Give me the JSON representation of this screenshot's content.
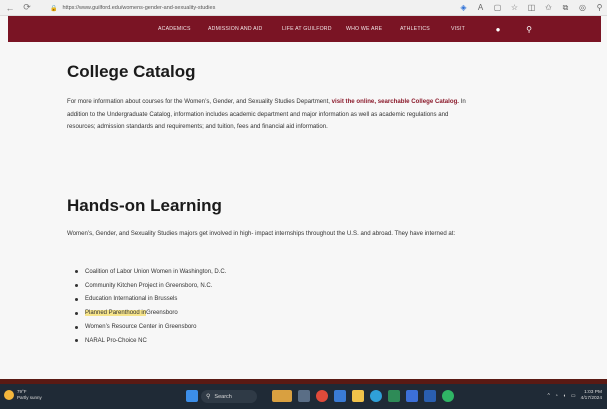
{
  "browser": {
    "url": "https://www.guilford.edu/womens-gender-and-sexuality-studies",
    "back_icon": "arrow-left",
    "reload_icon": "reload"
  },
  "sitenav": {
    "items": [
      "Academics",
      "Admission and Aid",
      "Life at Guilford",
      "Who We Are",
      "Athletics",
      "Visit"
    ]
  },
  "catalog": {
    "title": "College Catalog",
    "text_before": "For more information about courses for the Women’s, Gender, and Sexuality Studies Department, ",
    "link": "visit the online, searchable College Catalog.",
    "text_after": " In addition to the Undergraduate Catalog, information includes academic department and major information as well as academic regulations and resources; admission standards and requirements; and tuition, fees and financial aid information."
  },
  "hands_on": {
    "title": "Hands-on Learning",
    "intro": "Women’s, Gender, and Sexuality Studies majors get involved in high- impact internships throughout the U.S. and abroad. They have interned at:",
    "list": [
      "Coalition of Labor Union Women in Washington, D.C.",
      "Community Kitchen Project in Greensboro, N.C.",
      "Education International in Brussels",
      "Planned Parenthood in Greensboro",
      "Women’s Resource Center in Greensboro",
      "NARAL Pro-Choice NC"
    ],
    "highlight_text": "Planned Parenthood in",
    "highlight_rest": " Greensboro"
  },
  "taskbar": {
    "weather_temp": "79°F",
    "weather_desc": "Partly sunny",
    "search_label": "Search",
    "time": "1:03 PM",
    "date": "4/17/2024"
  },
  "colors": {
    "brand": "#7a1424",
    "link": "#8b1a2b",
    "highlight": "#f6e48a"
  }
}
